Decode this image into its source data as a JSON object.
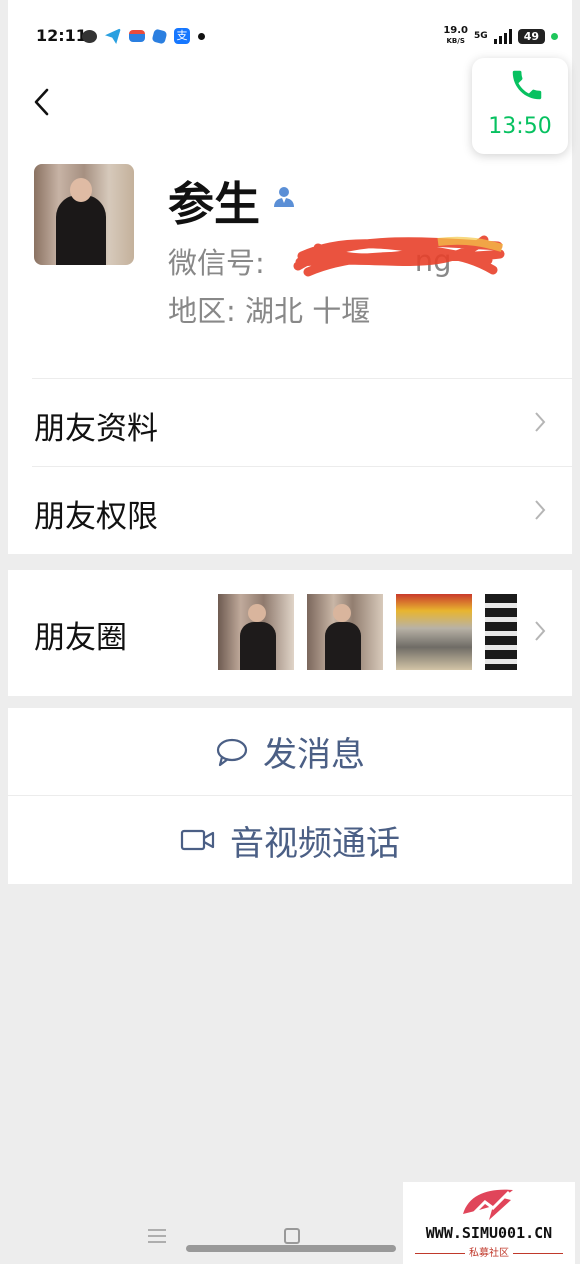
{
  "status_bar": {
    "time": "12:11",
    "net_speed": "19.0",
    "net_unit": "KB/S",
    "signal_label": "5G",
    "battery": "49"
  },
  "call_float": {
    "duration": "13:50"
  },
  "profile": {
    "nickname": "参生",
    "wechat_id_label": "微信号: ",
    "wechat_id_visible": "ng",
    "region_label": "地区: ",
    "region_value": "湖北  十堰"
  },
  "menu": {
    "friend_info": "朋友资料",
    "friend_permissions": "朋友权限",
    "moments": "朋友圈"
  },
  "actions": {
    "send_message": "发消息",
    "video_call": "音视频通话"
  },
  "watermark": {
    "url": "WWW.SIMU001.CN",
    "subtitle": "私募社区"
  },
  "colors": {
    "accent_green": "#07c160",
    "action_blue": "#4b5f85",
    "redaction_red": "#e8402a"
  }
}
